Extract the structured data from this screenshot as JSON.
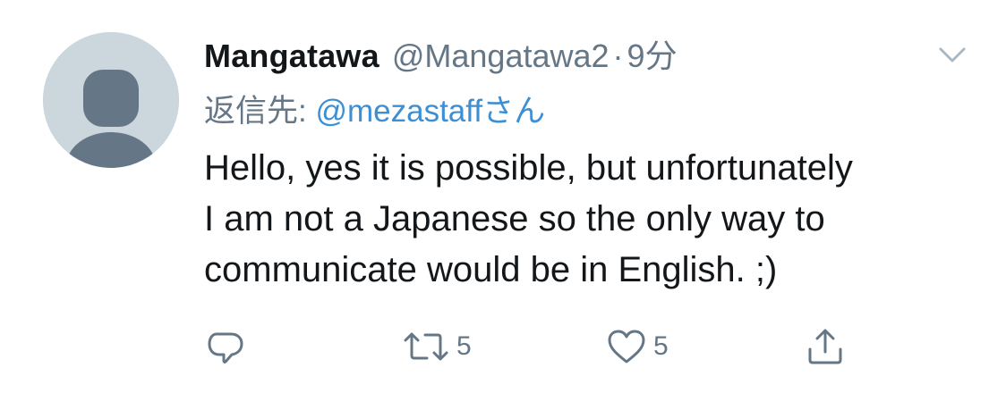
{
  "tweet": {
    "display_name": "Mangatawa",
    "handle": "@Mangatawa2",
    "separator": "·",
    "time": "9分",
    "reply_label": "返信先: ",
    "reply_user": "@mezastaff",
    "reply_suffix": "さん",
    "body_lines": [
      "Hello, yes it is possible, but unfortunately",
      "I am not a Japanese so the only way to",
      "communicate would be in English. ;)"
    ]
  },
  "actions": {
    "reply": {
      "icon": "reply-icon",
      "count": ""
    },
    "retweet": {
      "icon": "retweet-icon",
      "count": "5"
    },
    "like": {
      "icon": "heart-icon",
      "count": "5"
    },
    "share": {
      "icon": "share-icon",
      "count": ""
    }
  },
  "colors": {
    "name": "#14171a",
    "meta": "#657786",
    "link": "#3d8fd4",
    "avatar_bg": "#ccd6dd",
    "avatar_figure": "#657786"
  },
  "icons": {
    "avatar": "default-avatar-silhouette",
    "caret": "chevron-down-icon"
  }
}
